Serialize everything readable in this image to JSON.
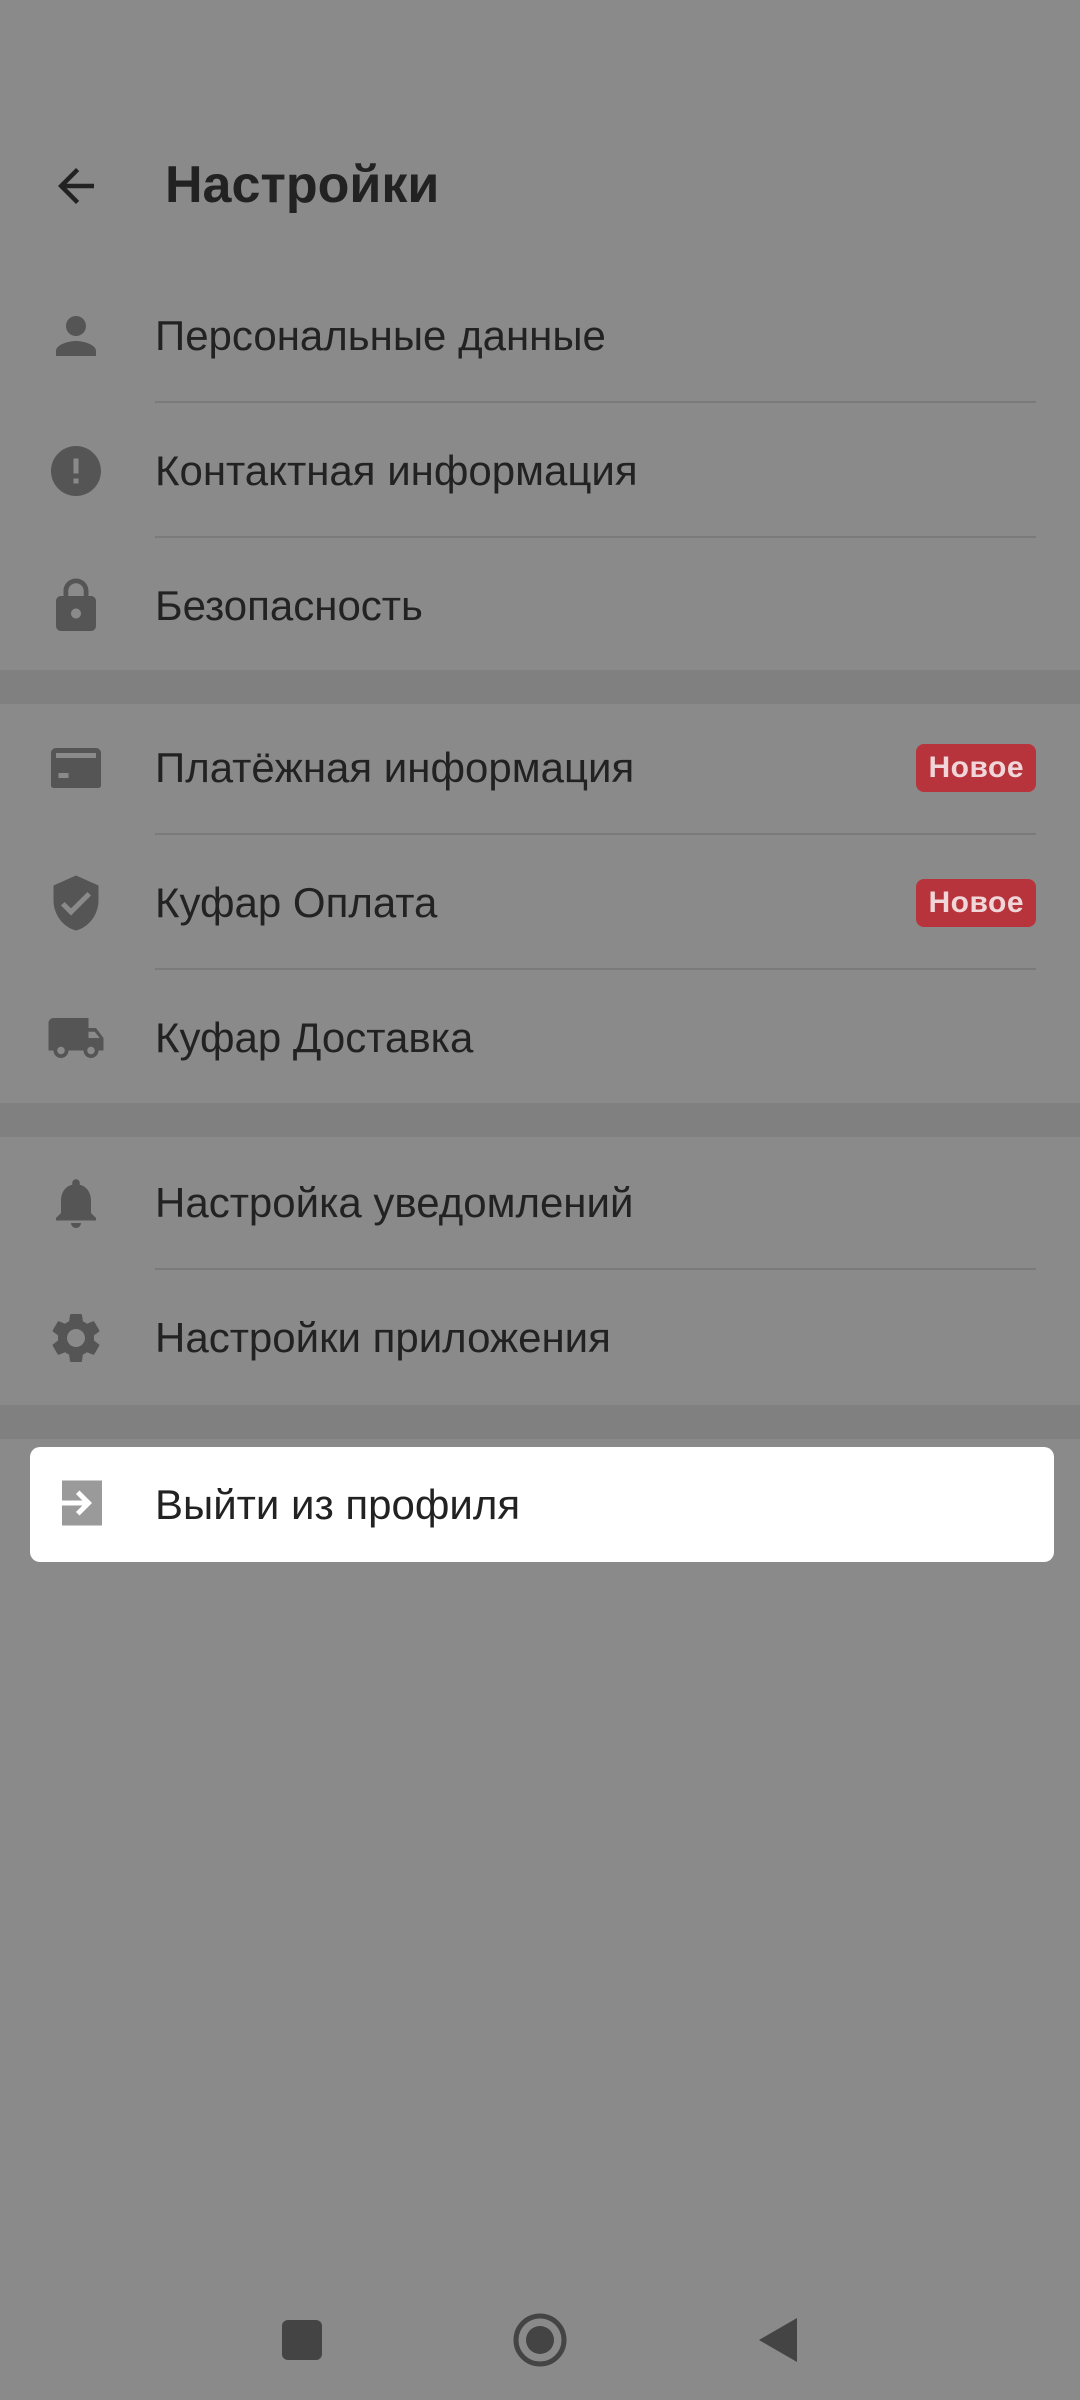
{
  "header": {
    "title": "Настройки",
    "back_icon": "arrow-left-icon"
  },
  "sections": [
    {
      "items": [
        {
          "label": "Персональные данные",
          "icon": "person-icon"
        },
        {
          "label": "Контактная информация",
          "icon": "alert-circle-icon"
        },
        {
          "label": "Безопасность",
          "icon": "lock-icon"
        }
      ]
    },
    {
      "items": [
        {
          "label": "Платёжная информация",
          "icon": "credit-card-icon",
          "badge": "Новое"
        },
        {
          "label": "Куфар Оплата",
          "icon": "shield-check-icon",
          "badge": "Новое"
        },
        {
          "label": "Куфар Доставка",
          "icon": "truck-icon"
        }
      ]
    },
    {
      "items": [
        {
          "label": "Настройка уведомлений",
          "icon": "bell-icon"
        },
        {
          "label": "Настройки приложения",
          "icon": "gear-icon"
        }
      ]
    }
  ],
  "logout": {
    "label": "Выйти из профиля",
    "icon": "logout-icon"
  },
  "nav_bar": {
    "recents_icon": "square-icon",
    "home_icon": "circle-home-icon",
    "back_icon": "triangle-back-icon"
  },
  "colors": {
    "background": "#8a8a8a",
    "badge": "#b8343c",
    "text": "#222222",
    "icon": "#555555"
  }
}
